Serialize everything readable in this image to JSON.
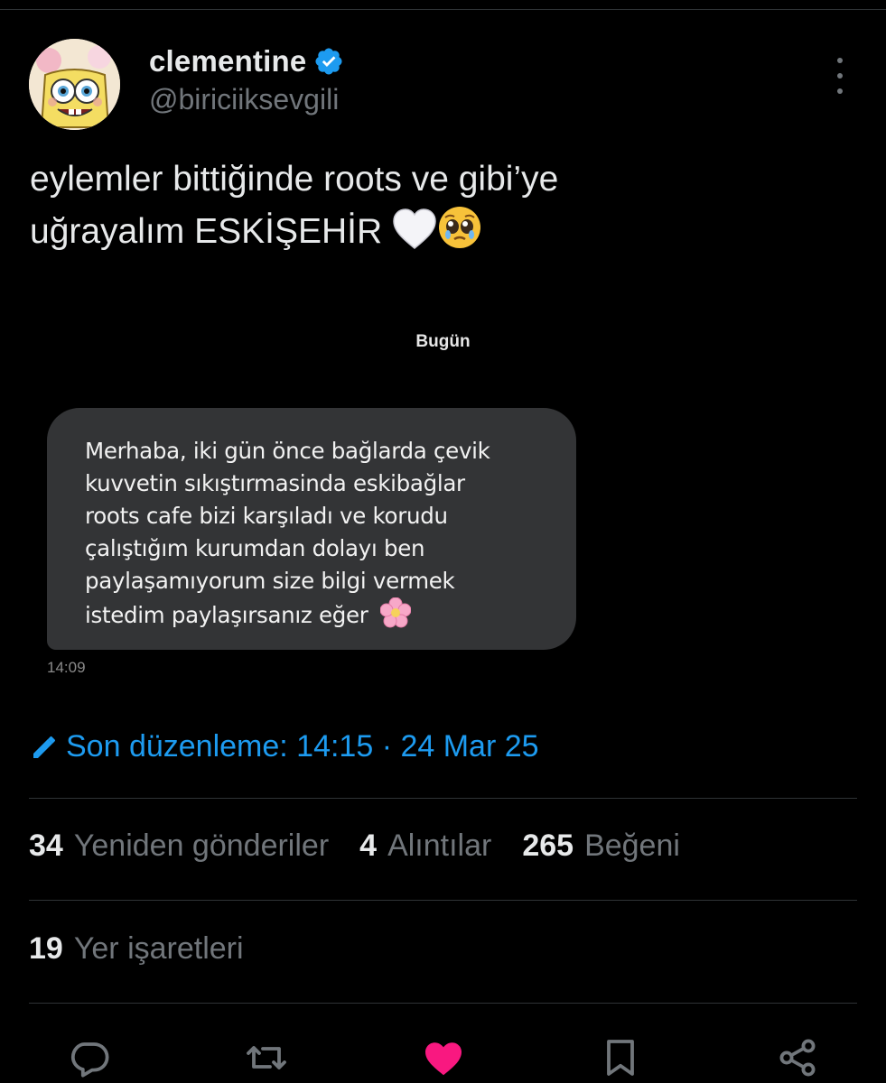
{
  "tweet": {
    "author": {
      "display_name": "clementine",
      "handle": "@biriciiksevgili",
      "verified": true
    },
    "text_line1": "eylemler bittiğinde roots ve gibi’ye",
    "text_line2": "uğrayalım ESKİŞEHİR"
  },
  "embedded_message": {
    "day_label": "Bugün",
    "lines": [
      "Merhaba, iki gün önce bağlarda çevik",
      "kuvvetin sıkıştırmasinda eskibağlar",
      "roots cafe bizi karşıladı ve korudu",
      "çalıştığım kurumdan dolayı ben",
      "paylaşamıyorum size bilgi vermek",
      "istedim paylaşırsanız eğer"
    ],
    "time": "14:09"
  },
  "edited": {
    "label": "Son düzenleme: 14:15 · 24 Mar 25"
  },
  "stats": {
    "reposts": {
      "count": "34",
      "label": "Yeniden gönderiler"
    },
    "quotes": {
      "count": "4",
      "label": "Alıntılar"
    },
    "likes": {
      "count": "265",
      "label": "Beğeni"
    },
    "bookmarks": {
      "count": "19",
      "label": "Yer işaretleri"
    }
  },
  "colors": {
    "background": "#000000",
    "accent": "#1d9bf0",
    "like": "#f91880",
    "muted": "#71767b",
    "bubble": "#333436"
  },
  "icons": {
    "verified": "verified-badge-icon",
    "more": "more-options-icon",
    "edit": "pencil-icon",
    "reply": "reply-icon",
    "retweet": "retweet-icon",
    "like": "heart-icon",
    "bookmark": "bookmark-icon",
    "share": "share-icon"
  }
}
